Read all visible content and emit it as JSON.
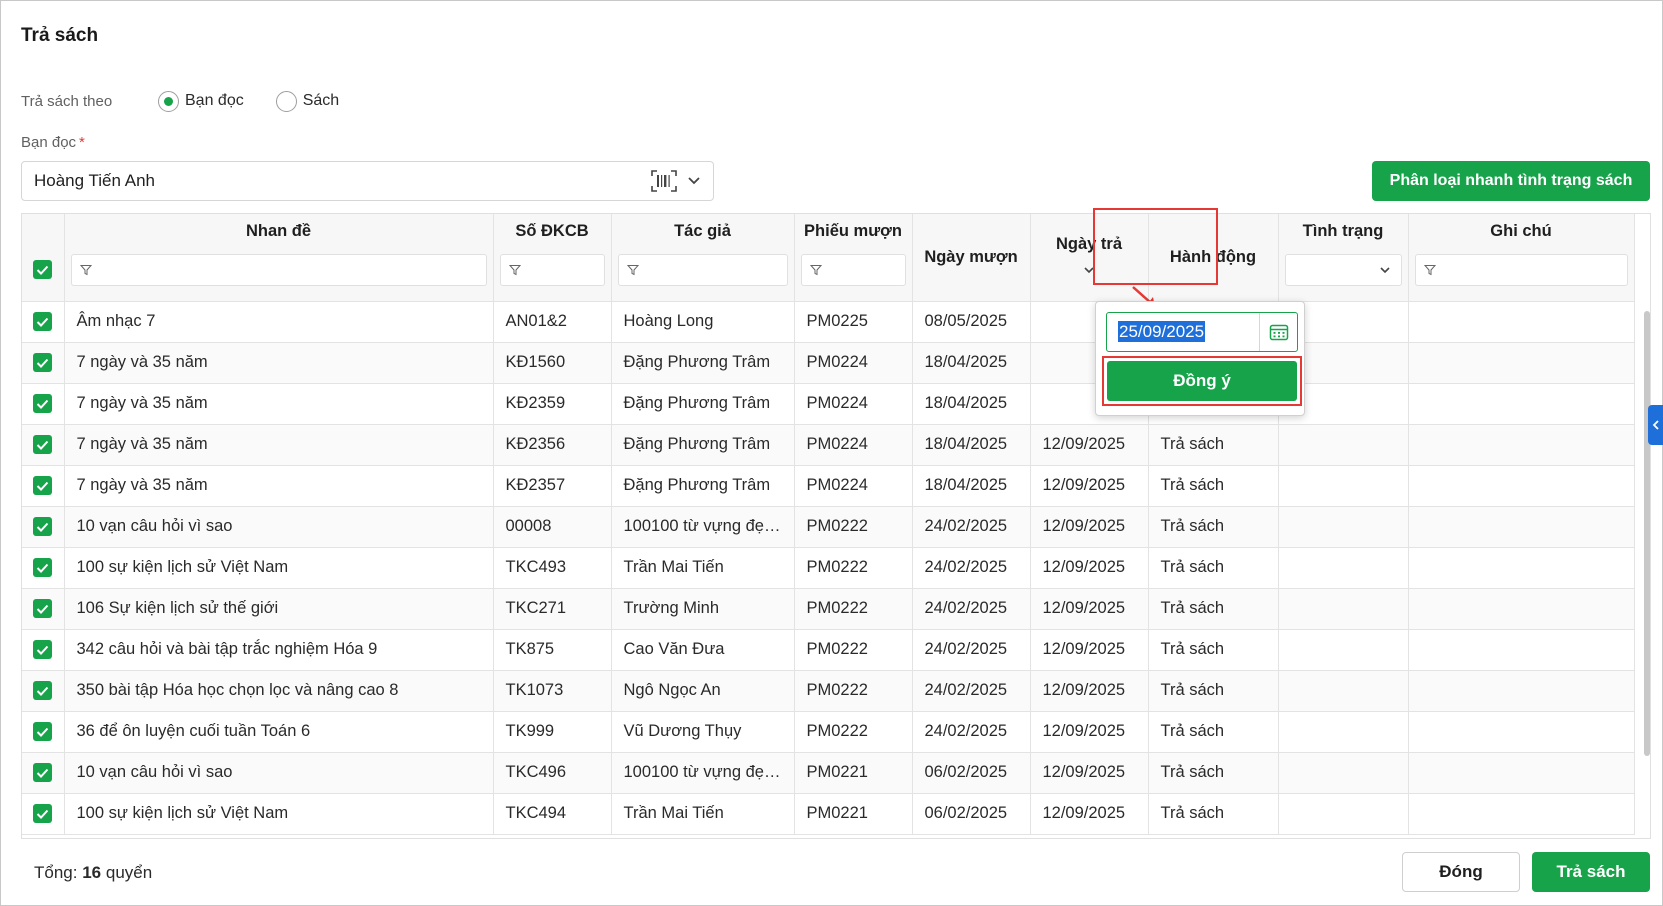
{
  "dialog": {
    "title": "Trả sách"
  },
  "mode": {
    "label": "Trả sách theo",
    "options": [
      {
        "label": "Bạn đọc",
        "checked": true
      },
      {
        "label": "Sách",
        "checked": false
      }
    ]
  },
  "reader": {
    "label": "Bạn đọc",
    "required_mark": "*",
    "value": "Hoàng Tiến Anh"
  },
  "quick_classify_label": "Phân loại nhanh tình trạng sách",
  "table": {
    "headers": {
      "title": "Nhan đề",
      "reg_no": "Số ĐKCB",
      "author": "Tác giả",
      "slip": "Phiếu mượn",
      "borrow_date": "Ngày mượn",
      "return_date": "Ngày trả",
      "action": "Hành động",
      "status": "Tình trạng",
      "note": "Ghi chú"
    },
    "rows": [
      {
        "title": "Âm nhạc 7",
        "reg_no": "AN01&2",
        "author": "Hoàng Long",
        "slip": "PM0225",
        "borrow_date": "08/05/2025",
        "return_date": "",
        "action": ""
      },
      {
        "title": "7 ngày và 35 năm",
        "reg_no": "KĐ1560",
        "author": "Đặng Phương Trâm",
        "slip": "PM0224",
        "borrow_date": "18/04/2025",
        "return_date": "",
        "action": ""
      },
      {
        "title": "7 ngày và 35 năm",
        "reg_no": "KĐ2359",
        "author": "Đặng Phương Trâm",
        "slip": "PM0224",
        "borrow_date": "18/04/2025",
        "return_date": "",
        "action": ""
      },
      {
        "title": "7 ngày và 35 năm",
        "reg_no": "KĐ2356",
        "author": "Đặng Phương Trâm",
        "slip": "PM0224",
        "borrow_date": "18/04/2025",
        "return_date": "12/09/2025",
        "action": "Trả sách"
      },
      {
        "title": "7 ngày và 35 năm",
        "reg_no": "KĐ2357",
        "author": "Đặng Phương Trâm",
        "slip": "PM0224",
        "borrow_date": "18/04/2025",
        "return_date": "12/09/2025",
        "action": "Trả sách"
      },
      {
        "title": "10 vạn câu hỏi vì sao",
        "reg_no": "00008",
        "author": "100100 từ vựng đẹp ...",
        "slip": "PM0222",
        "borrow_date": "24/02/2025",
        "return_date": "12/09/2025",
        "action": "Trả sách"
      },
      {
        "title": "100 sự kiện lịch sử Việt Nam",
        "reg_no": "TKC493",
        "author": "Trần Mai Tiến",
        "slip": "PM0222",
        "borrow_date": "24/02/2025",
        "return_date": "12/09/2025",
        "action": "Trả sách"
      },
      {
        "title": "106 Sự kiện lịch sử thế giới",
        "reg_no": "TKC271",
        "author": "Trường Minh",
        "slip": "PM0222",
        "borrow_date": "24/02/2025",
        "return_date": "12/09/2025",
        "action": "Trả sách"
      },
      {
        "title": "342 câu hỏi và bài tập trắc nghiệm Hóa 9",
        "reg_no": "TK875",
        "author": "Cao Văn Đưa",
        "slip": "PM0222",
        "borrow_date": "24/02/2025",
        "return_date": "12/09/2025",
        "action": "Trả sách"
      },
      {
        "title": "350 bài tập Hóa học chọn lọc và nâng cao 8",
        "reg_no": "TK1073",
        "author": "Ngô Ngọc An",
        "slip": "PM0222",
        "borrow_date": "24/02/2025",
        "return_date": "12/09/2025",
        "action": "Trả sách"
      },
      {
        "title": "36 để ôn luyện cuối tuần Toán 6",
        "reg_no": "TK999",
        "author": "Vũ Dương Thụy",
        "slip": "PM0222",
        "borrow_date": "24/02/2025",
        "return_date": "12/09/2025",
        "action": "Trả sách"
      },
      {
        "title": "10 vạn câu hỏi vì sao",
        "reg_no": "TKC496",
        "author": "100100 từ vựng đẹp ...",
        "slip": "PM0221",
        "borrow_date": "06/02/2025",
        "return_date": "12/09/2025",
        "action": "Trả sách"
      },
      {
        "title": "100 sự kiện lịch sử Việt Nam",
        "reg_no": "TKC494",
        "author": "Trần Mai Tiến",
        "slip": "PM0221",
        "borrow_date": "06/02/2025",
        "return_date": "12/09/2025",
        "action": "Trả sách"
      }
    ]
  },
  "popup": {
    "date_value": "25/09/2025",
    "confirm_label": "Đồng ý"
  },
  "footer": {
    "total_prefix": "Tổng:",
    "total_count": "16",
    "total_unit": "quyển",
    "close_label": "Đóng",
    "return_label": "Trả sách"
  },
  "colors": {
    "primary": "#16a34a",
    "highlight": "#e53935",
    "selection": "#1e6fd9"
  }
}
